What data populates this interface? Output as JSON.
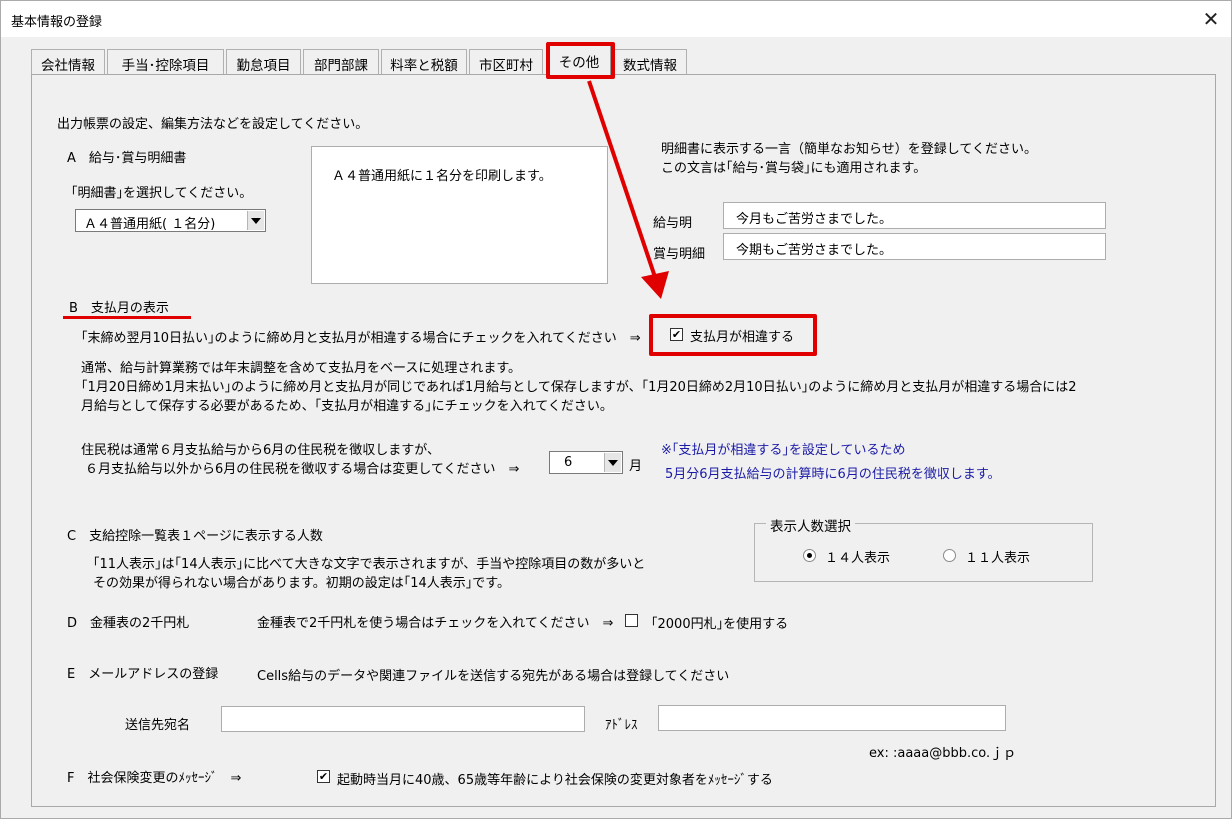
{
  "window": {
    "title": "基本情報の登録",
    "close_glyph": "✕"
  },
  "tabs": [
    {
      "label": "会社情報",
      "active": false
    },
    {
      "label": "手当･控除項目",
      "active": false
    },
    {
      "label": "勤怠項目",
      "active": false
    },
    {
      "label": "部門部課",
      "active": false
    },
    {
      "label": "料率と税額",
      "active": false
    },
    {
      "label": "市区町村",
      "active": false
    },
    {
      "label": "その他",
      "active": true
    },
    {
      "label": "数式情報",
      "active": false
    }
  ],
  "intro": "出力帳票の設定、編集方法などを設定してください。",
  "section_a": {
    "heading": "A　給与･賞与明細書",
    "prompt": "｢明細書｣を選択してください。",
    "select_value": "Ａ４普通用紙( １名分)",
    "preview_text": "Ａ４普通用紙に１名分を印刷します。",
    "message_note_1": "明細書に表示する一言（簡単なお知らせ）を登録してください。",
    "message_note_2": "この文言は｢給与･賞与袋｣にも適用されます。",
    "salary_label": "給与明",
    "salary_value": "今月もご苦労さまでした。",
    "bonus_label": "賞与明細",
    "bonus_value": "今期もご苦労さまでした。"
  },
  "section_b": {
    "heading": "B　支払月の表示",
    "prompt": "｢末締め翌月10日払い｣のように締め月と支払月が相違する場合にチェックを入れてください　⇒",
    "checkbox_label": "支払月が相違する",
    "checkbox_checked": true,
    "desc_1": "通常、給与計算業務では年末調整を含めて支払月をベースに処理されます。",
    "desc_2": "｢1月20日締め1月末払い｣のように締め月と支払月が同じであれば1月給与として保存しますが、｢1月20日締め2月10日払い｣のように締め月と支払月が相違する場合には2",
    "desc_3": "月給与として保存する必要があるため、｢支払月が相違する｣にチェックを入れてください。",
    "resident_1": "住民税は通常６月支払給与から6月の住民税を徴収しますが、",
    "resident_2": "６月支払給与以外から6月の住民税を徴収する場合は変更してください　⇒",
    "month_value": "6",
    "month_unit": "月",
    "note_1": "※｢支払月が相違する｣を設定しているため",
    "note_2": "5月分6月支払給与の計算時に6月の住民税を徴収します。"
  },
  "section_c": {
    "heading": "C　支給控除一覧表１ページに表示する人数",
    "desc_1": "｢11人表示｣は｢14人表示｣に比べて大きな文字で表示されますが、手当や控除項目の数が多いと",
    "desc_2": "その効果が得られない場合があります。初期の設定は｢14人表示｣です。",
    "group_title": "表示人数選択",
    "option_14": "１４人表示",
    "option_11": "１１人表示",
    "selected": "14"
  },
  "section_d": {
    "heading": "D　金種表の2千円札",
    "prompt": "金種表で2千円札を使う場合はチェックを入れてください　⇒",
    "checkbox_label": "｢2000円札｣を使用する",
    "checkbox_checked": false
  },
  "section_e": {
    "heading": "E　メールアドレスの登録",
    "prompt": "Cells給与のデータや関連ファイルを送信する宛先がある場合は登録してください",
    "name_label": "送信先宛名",
    "name_value": "",
    "address_label": "ｱﾄﾞﾚｽ",
    "address_value": "",
    "example": "ex: :aaaa@bbb.co.ｊｐ"
  },
  "section_f": {
    "heading": "F　社会保険変更のﾒｯｾｰｼﾞ　⇒",
    "checkbox_label": "起動時当月に40歳、65歳等年齢により社会保険の変更対象者をﾒｯｾｰｼﾞする",
    "checkbox_checked": true
  },
  "colors": {
    "highlight": "#e00000",
    "note_text": "#1a1aa6",
    "window_bg": "#f0f0f0"
  }
}
